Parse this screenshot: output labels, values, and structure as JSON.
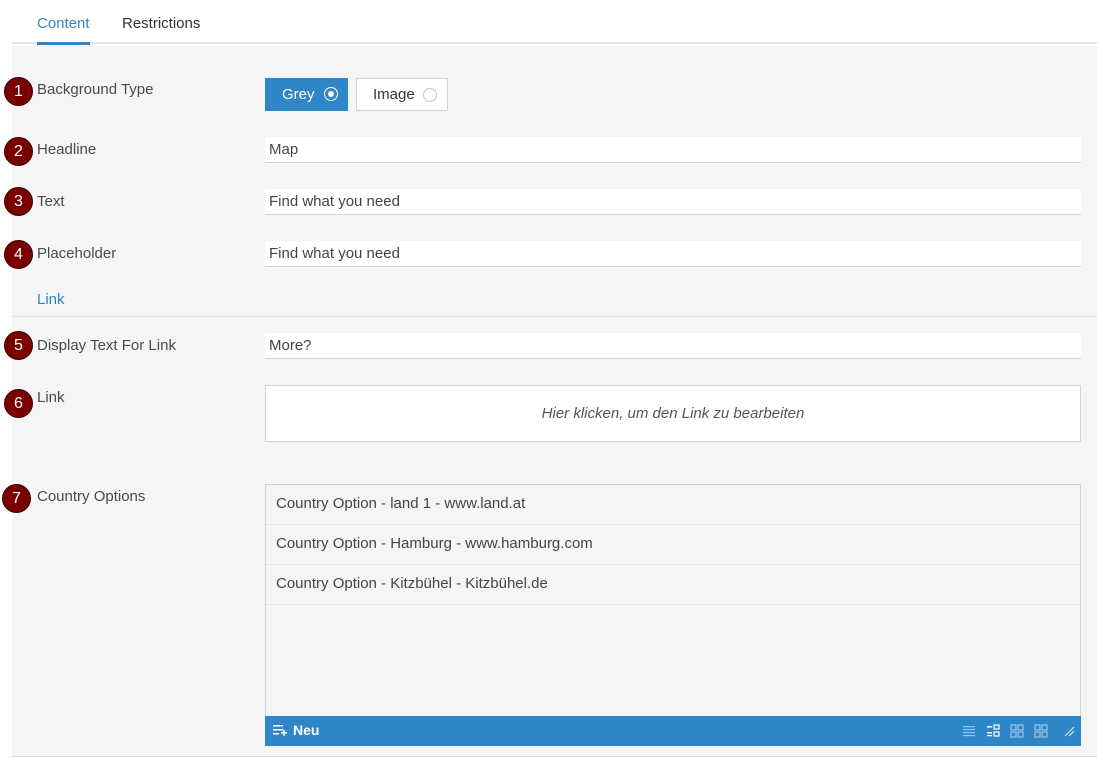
{
  "tabs": [
    {
      "label": "Content",
      "active": true
    },
    {
      "label": "Restrictions",
      "active": false
    }
  ],
  "accent_color": "#2f86c6",
  "badge_color": "#7a0000",
  "fields": {
    "background_type": {
      "number": "1",
      "label": "Background Type",
      "options": [
        "Grey",
        "Image"
      ],
      "selected": "Grey"
    },
    "headline": {
      "number": "2",
      "label": "Headline",
      "value": "Map"
    },
    "text": {
      "number": "3",
      "label": "Text",
      "value": "Find what you need"
    },
    "placeholder": {
      "number": "4",
      "label": "Placeholder",
      "value": "Find what you need"
    },
    "link_section": {
      "label": "Link"
    },
    "display_text": {
      "number": "5",
      "label": "Display Text For Link",
      "value": "More?"
    },
    "link": {
      "number": "6",
      "label": "Link",
      "value": "Hier klicken, um den Link zu bearbeiten"
    },
    "country_options": {
      "number": "7",
      "label": "Country Options",
      "items": [
        "Country Option - land 1 - www.land.at",
        "Country Option - Hamburg - www.hamburg.com",
        "Country Option - Kitzbühel - Kitzbühel.de"
      ],
      "new_label": "Neu",
      "toolbar_icons": [
        "list-view-icon",
        "detail-view-icon",
        "small-grid-icon",
        "large-grid-icon",
        "resize-handle-icon"
      ]
    }
  }
}
